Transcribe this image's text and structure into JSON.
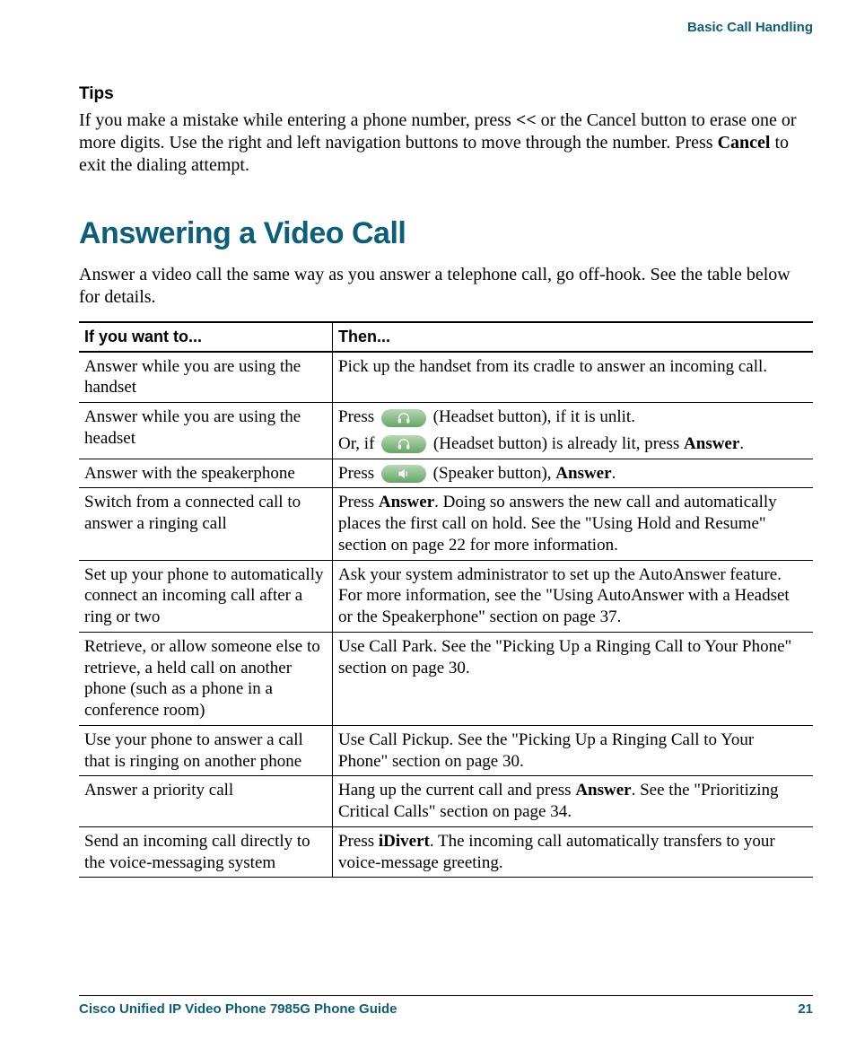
{
  "running_header": "Basic Call Handling",
  "tips": {
    "heading": "Tips",
    "body_parts": [
      "If you make a mistake while entering a phone number, press ",
      "<<",
      " or the Cancel button to erase one or more digits. Use the right and left navigation buttons to move through the number. Press ",
      "Cancel",
      " to exit the dialing attempt."
    ]
  },
  "section": {
    "title": "Answering a Video Call",
    "intro": "Answer a video call the same way as you answer a telephone call, go off-hook. See the table below for details.",
    "headers": [
      "If you want to...",
      "Then..."
    ],
    "rows": [
      {
        "want": "Answer while you are using the handset",
        "then_simple": "Pick up the handset from its cradle to answer an incoming call."
      },
      {
        "want": "Answer while you are using the headset",
        "then_headset": {
          "press": "Press ",
          "after_icon_1": " (Headset button), if it is unlit.",
          "orif": "Or, if ",
          "after_icon_2_a": " (Headset button) is already lit, press ",
          "answer": "Answer",
          "period": "."
        }
      },
      {
        "want": "Answer with the speakerphone",
        "then_speaker": {
          "press": "Press ",
          "after_icon": " (Speaker button), ",
          "answer": "Answer",
          "period": "."
        }
      },
      {
        "want": "Switch from a connected call to answer a ringing call",
        "then_rich": {
          "pre": "Press ",
          "bold": "Answer",
          "post": ". Doing so answers the new call and automatically places the first call on hold. See the \"Using Hold and Resume\" section on page 22 for more information."
        }
      },
      {
        "want": "Set up your phone to automatically connect an incoming call after a ring or two",
        "then_simple": "Ask your system administrator to set up the AutoAnswer feature. For more information, see the \"Using AutoAnswer with a Headset or the Speakerphone\" section on page 37."
      },
      {
        "want": "Retrieve, or allow someone else to retrieve, a held call on another phone (such as a phone in a conference room)",
        "then_simple": "Use Call Park. See the \"Picking Up a Ringing Call to Your Phone\" section on page 30."
      },
      {
        "want": "Use your phone to answer a call that is ringing on another phone",
        "then_simple": "Use Call Pickup. See the \"Picking Up a Ringing Call to Your Phone\" section on page 30."
      },
      {
        "want": "Answer a priority call",
        "then_rich": {
          "pre": "Hang up the current call and press ",
          "bold": "Answer",
          "post": ". See the \"Prioritizing Critical Calls\" section on page 34."
        }
      },
      {
        "want": "Send an incoming call directly to the voice-messaging system",
        "then_rich": {
          "pre": "Press ",
          "bold": "iDivert",
          "post": ". The incoming call automatically transfers to your voice-message greeting."
        }
      }
    ]
  },
  "footer": {
    "title": "Cisco Unified IP Video Phone 7985G Phone Guide",
    "page": "21"
  }
}
